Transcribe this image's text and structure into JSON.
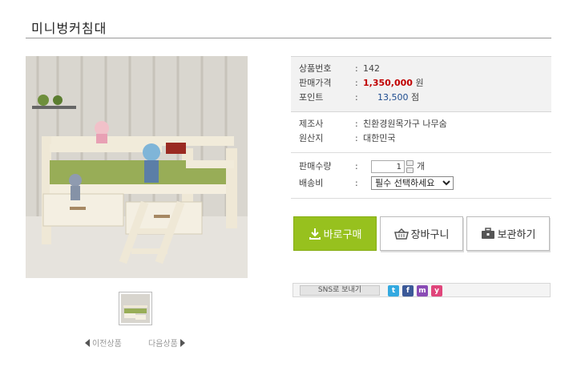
{
  "page": {
    "title": "미니벙커침대"
  },
  "product": {
    "code_label": "상품번호",
    "code_value": "142",
    "price_label": "판매가격",
    "price_value": "1,350,000",
    "price_unit": "원",
    "point_label": "포인트",
    "point_value": "13,500",
    "point_unit": "점",
    "maker_label": "제조사",
    "maker_value": "친환경원목가구 나무숨",
    "origin_label": "원산지",
    "origin_value": "대한민국",
    "qty_label": "판매수량",
    "qty_value": "1",
    "qty_unit": "개",
    "ship_label": "배송비",
    "ship_selected": "필수 선택하세요",
    "colon": ":"
  },
  "buttons": {
    "buy": "바로구매",
    "cart": "장바구니",
    "keep": "보관하기"
  },
  "sns": {
    "label": "SNS로 보내기",
    "icons": [
      "twitter-icon",
      "facebook-icon",
      "me2day-icon",
      "yozm-icon"
    ]
  },
  "gallery": {
    "prev": "이전상품",
    "next": "다음상품"
  },
  "colors": {
    "accent_buy": "#97c11e",
    "price": "#c00000",
    "point": "#1e4c8f"
  }
}
